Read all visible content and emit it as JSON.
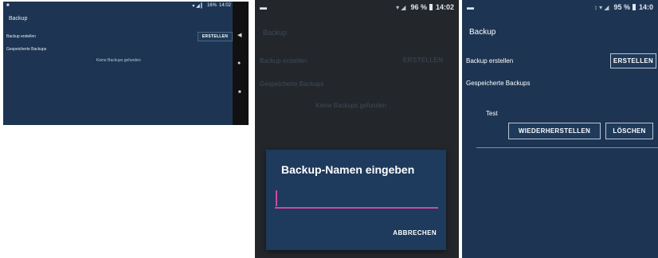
{
  "screen1": {
    "status": {
      "signal": "▾ ◢ ▎",
      "battery": "16%",
      "time": "14:02"
    },
    "title": "Backup",
    "create_label": "Backup erstellen",
    "create_button": "ERSTELLEN",
    "saved_label": "Gespeicherte Backups",
    "empty_message": "Keine Backups gefunden",
    "nav": {
      "back": "◀",
      "home": "●",
      "recent": "■"
    }
  },
  "screen2": {
    "status": {
      "signal": "▾ ◢",
      "battery": "96 %",
      "time": "14:02"
    },
    "title": "Backup",
    "create_label": "Backup erstellen",
    "create_button": "ERSTELLEN",
    "saved_label": "Gespeicherte Backups",
    "empty_message": "Keine Backups gefunden",
    "dialog": {
      "title": "Backup-Namen eingeben",
      "input_value": "",
      "cancel_button": "ABBRECHEN"
    }
  },
  "screen3": {
    "status": {
      "signal": "↕ ▾ ◢",
      "battery": "95 %",
      "time": "14:0"
    },
    "title": "Backup",
    "create_label": "Backup erstellen",
    "create_button": "ERSTELLEN",
    "saved_label": "Gespeicherte Backups",
    "item_name": "Test",
    "restore_button": "WIEDERHERSTELLEN",
    "delete_button": "LÖSCHEN"
  },
  "colors": {
    "app_background": "#1d3553",
    "dialog_background": "#1e3a5c",
    "dimmed_overlay": "#23272c",
    "input_underline": "#d04aa0",
    "nav_bar": "#111111"
  }
}
